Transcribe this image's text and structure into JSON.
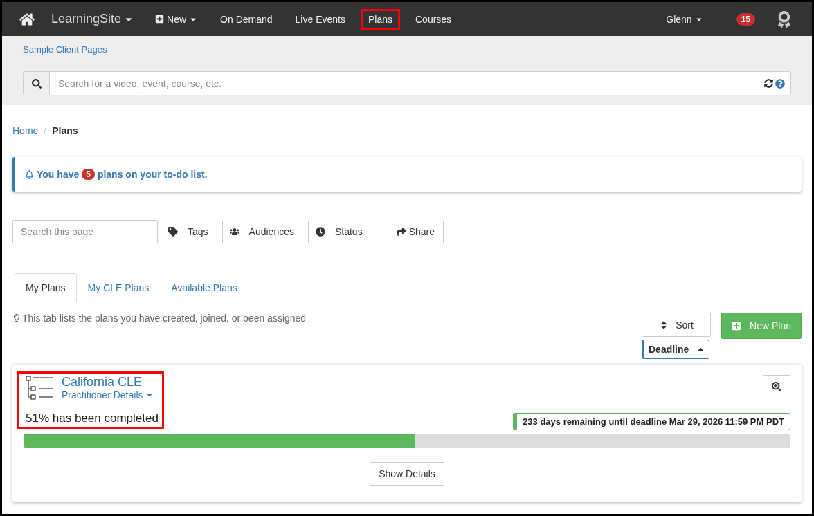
{
  "navbar": {
    "brand": "LearningSite",
    "items": [
      {
        "label": "New",
        "kind": "new",
        "highlighted": false
      },
      {
        "label": "On Demand",
        "kind": "link",
        "highlighted": false
      },
      {
        "label": "Live Events",
        "kind": "link",
        "highlighted": false
      },
      {
        "label": "Plans",
        "kind": "link",
        "highlighted": true
      },
      {
        "label": "Courses",
        "kind": "link",
        "highlighted": false
      }
    ],
    "user": "Glenn",
    "notification_count": "15"
  },
  "subbar": {
    "link": "Sample Client Pages"
  },
  "search": {
    "placeholder": "Search for a video, event, course, etc."
  },
  "breadcrumb_separator": "/",
  "breadcrumb": [
    {
      "label": "Home",
      "kind": "link"
    },
    {
      "label": "Plans",
      "kind": "current"
    }
  ],
  "alert": {
    "before": "You have",
    "count": "5",
    "after": "plans on your to-do list."
  },
  "filters": {
    "placeholder": "Search this page",
    "buttons": [
      {
        "label": "Tags",
        "kind": "tag"
      },
      {
        "label": "Audiences",
        "kind": "users"
      },
      {
        "label": "Status",
        "kind": "clock"
      }
    ],
    "share": "Share"
  },
  "tabs": [
    {
      "label": "My Plans",
      "selected": true
    },
    {
      "label": "My CLE Plans",
      "selected": false
    },
    {
      "label": "Available Plans",
      "selected": false
    }
  ],
  "hint": "This tab lists the plans you have created, joined, or been assigned",
  "sort": {
    "label": "Sort",
    "field": "Deadline"
  },
  "new_plan": "New Plan",
  "plans": [
    {
      "title": "California CLE",
      "subtitle": "Practitioner Details",
      "progress_text": "51% has been completed",
      "level": 0.51,
      "deadline": "233 days remaining until deadline Mar 29, 2026 11:59 PM PDT",
      "highlighted": true,
      "button": "Show Details"
    }
  ]
}
